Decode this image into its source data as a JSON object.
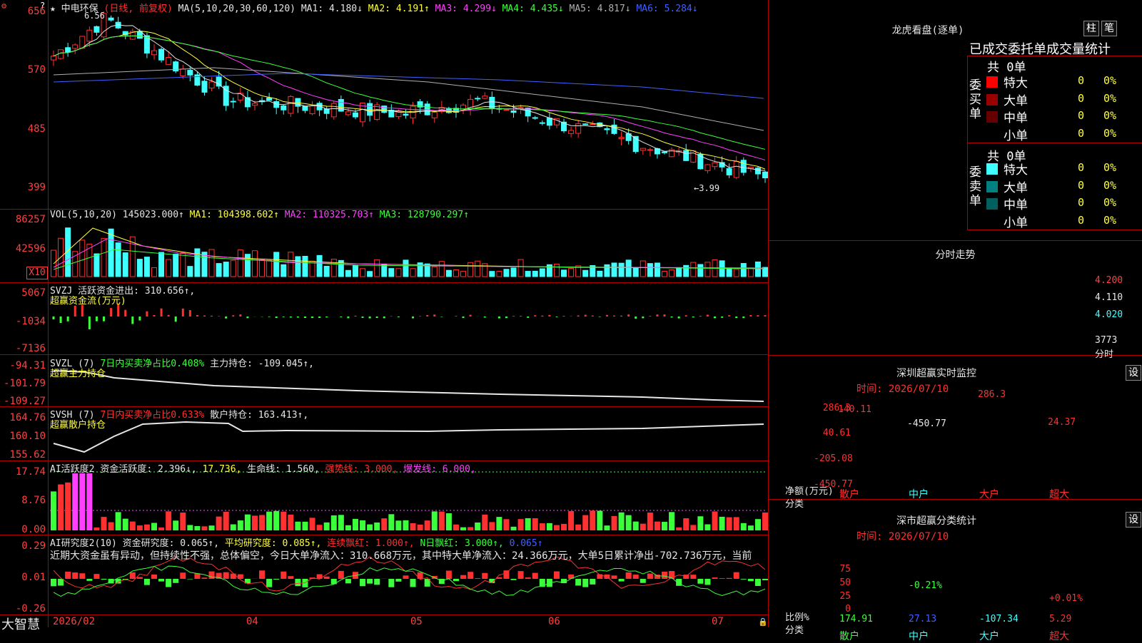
{
  "stock": {
    "name": "中电环保",
    "mode": "(日线, 前复权)"
  },
  "main": {
    "ma_label": "MA(5,10,20,30,60,120)",
    "ma": [
      {
        "k": "MA1:",
        "v": "4.180↓",
        "color": "#e6e6e6"
      },
      {
        "k": "MA2:",
        "v": "4.191↑",
        "color": "#ffff3c"
      },
      {
        "k": "MA3:",
        "v": "4.299↓",
        "color": "#ff40ff"
      },
      {
        "k": "MA4:",
        "v": "4.435↓",
        "color": "#3cff3c"
      },
      {
        "k": "MA5:",
        "v": "4.817↓",
        "color": "#b0b0b0"
      },
      {
        "k": "MA6:",
        "v": "5.284↓",
        "color": "#4060ff"
      }
    ],
    "yaxis": [
      "656",
      "570",
      "485",
      "399"
    ],
    "high_label": "6.56",
    "low_label": "←3.99"
  },
  "vol": {
    "label": "VOL(5,10,20)",
    "value": "145023.000↑",
    "ma1": "MA1: 104398.602↑",
    "ma2": "MA2: 110325.703↑",
    "ma3": "MA3: 128790.297↑",
    "yaxis": [
      "86257",
      "42596"
    ],
    "unit": "X10"
  },
  "svzj": {
    "label": "SVZJ",
    "line1": "活跃资金进出: 310.656↑,",
    "line2": "超赢资金流(万元)",
    "yaxis": [
      "5067",
      "-1034",
      "-7136"
    ]
  },
  "svzl": {
    "label": "SVZL (7)",
    "t1": "7日内买卖净占比0.408%",
    "t2": "主力持仓: -109.045↑,",
    "t3": "超赢主力持仓",
    "yaxis": [
      "-94.31",
      "-101.79",
      "-109.27"
    ]
  },
  "svsh": {
    "label": "SVSH (7)",
    "t1": "7日内买卖净占比0.633%",
    "t2": "散户持仓: 163.413↑,",
    "t3": "超赢散户持仓",
    "yaxis": [
      "164.76",
      "160.10",
      "155.62"
    ]
  },
  "ai1": {
    "label": "AI活跃度2",
    "t1": "资金活跃度: 2.396↓,",
    "t2": "17.736,",
    "t3": "生命线: 1.560,",
    "t4": "强势线: 3.000,",
    "t5": "爆发线: 6.000,",
    "yaxis": [
      "17.74",
      "8.76",
      "0.00"
    ]
  },
  "ai2": {
    "label": "AI研究度2(10)",
    "t1": "资金研究度: 0.065↑,",
    "t2": "平均研究度: 0.085↑,",
    "t3": "连续飘红: 1.000↑,",
    "t4": "N日飘红: 3.000↑,",
    "t5": "0.065↑",
    "comment": "近期大资金虽有异动，但持续性不强，总体偏空，今日大单净流入：310.668万元，其中特大单净流入：24.366万元，大单5日累计净出-702.736万元，当前",
    "yaxis": [
      "0.29",
      "0.01",
      "-0.26"
    ]
  },
  "xaxis": {
    "brand": "大智慧",
    "labels": [
      "2026/02",
      "04",
      "05",
      "06",
      "07"
    ]
  },
  "lhb": {
    "title": "龙虎看盘(逐单)",
    "btn1": "柱",
    "btn2": "笔",
    "subtitle": "已成交委托单成交量统计",
    "buy": {
      "side": "委买单",
      "total": "共 0单",
      "rows": [
        {
          "label": "特大",
          "n": "0",
          "p": "0%",
          "color": "#ff0000"
        },
        {
          "label": "大单",
          "n": "0",
          "p": "0%",
          "color": "#990000"
        },
        {
          "label": "中单",
          "n": "0",
          "p": "0%",
          "color": "#660000"
        },
        {
          "label": "小单",
          "n": "0",
          "p": "0%",
          "color": "#000000"
        }
      ]
    },
    "sell": {
      "side": "委卖单",
      "total": "共 0单",
      "rows": [
        {
          "label": "特大",
          "n": "0",
          "p": "0%",
          "color": "#40ffff"
        },
        {
          "label": "大单",
          "n": "0",
          "p": "0%",
          "color": "#008080"
        },
        {
          "label": "中单",
          "n": "0",
          "p": "0%",
          "color": "#006060"
        },
        {
          "label": "小单",
          "n": "0",
          "p": "0%",
          "color": "#000000"
        }
      ]
    }
  },
  "intraday": {
    "title": "分时走势",
    "yaxis": [
      "4.200",
      "4.110",
      "4.020"
    ],
    "vol_label": "3773",
    "vol_unit": "分时"
  },
  "monitor": {
    "title": "深圳超赢实时监控",
    "btn": "设",
    "time": "时间: 2026/07/10",
    "yaxis": [
      "286.3",
      "40.61",
      "-205.08",
      "-450.77"
    ],
    "ylabel1": "净额(万元)",
    "ylabel2": "分类",
    "cats": [
      "散户",
      "中户",
      "大户",
      "超大"
    ],
    "values": [
      140.11,
      -450.77,
      286.3,
      24.37
    ],
    "value_labels": [
      "140.11",
      "-450.77",
      "286.3",
      "24.37"
    ]
  },
  "classify": {
    "title": "深市超赢分类统计",
    "btn": "设",
    "time": "时间: 2026/07/10",
    "yaxis": [
      "75",
      "50",
      "25",
      "0"
    ],
    "ylabel1": "比例%",
    "ylabel2": "分类",
    "cats": [
      "散户",
      "中户",
      "大户",
      "超大"
    ],
    "pct_labels": [
      "",
      "-0.21%",
      "",
      "+0.01%"
    ],
    "bottom_values": [
      "174.91",
      "27.13",
      "-107.34",
      "5.29"
    ]
  }
}
